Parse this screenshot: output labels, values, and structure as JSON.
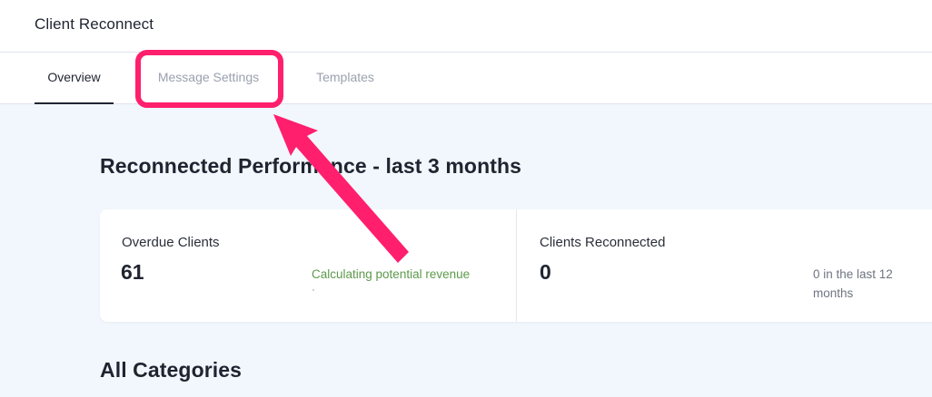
{
  "app": {
    "title": "Client Reconnect"
  },
  "tabs": [
    {
      "label": "Overview",
      "active": true
    },
    {
      "label": "Message Settings",
      "active": false
    },
    {
      "label": "Templates",
      "active": false
    }
  ],
  "performance": {
    "title": "Reconnected Performance - last 3 months",
    "metrics": [
      {
        "label": "Overdue Clients",
        "value": "61",
        "note": "Calculating potential revenue"
      },
      {
        "label": "Clients Reconnected",
        "value": "0",
        "note": "0 in the last 12 months"
      }
    ]
  },
  "categories": {
    "title": "All Categories"
  },
  "colors": {
    "annotation": "#ff1f6d",
    "positive_text": "#5d9a4b",
    "content_background": "#f1f7fc"
  }
}
